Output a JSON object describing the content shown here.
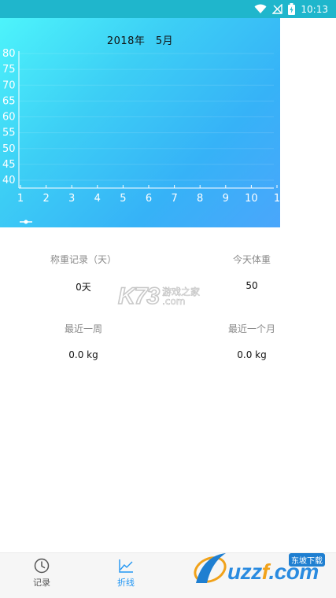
{
  "status_bar": {
    "time": "10:13",
    "icons": [
      "wifi-icon",
      "no-signal-icon",
      "battery-icon"
    ]
  },
  "chart": {
    "title": "2018年　5月",
    "colors": {
      "axis": "#ffffff",
      "grid": "#ffffff",
      "background_start": "#4df4fb",
      "background_end": "#4aa6fb"
    }
  },
  "chart_data": {
    "type": "line",
    "title": "2018年　5月",
    "x_ticks": [
      "1",
      "2",
      "3",
      "4",
      "5",
      "6",
      "7",
      "8",
      "9",
      "10",
      "1"
    ],
    "y_ticks": [
      "80",
      "75",
      "70",
      "65",
      "60",
      "55",
      "50",
      "45",
      "40"
    ],
    "ylim": [
      40,
      80
    ],
    "series": [],
    "grid": true,
    "legend": "bottom-left"
  },
  "stats": {
    "weigh_records_label": "称重记录（天）",
    "weigh_records_value": "0天",
    "today_weight_label": "今天体重",
    "today_weight_value": "50",
    "last_week_label": "最近一周",
    "last_week_value": "0.0 kg",
    "last_month_label": "最近一个月",
    "last_month_value": "0.0 kg"
  },
  "watermark": {
    "logo": "K73",
    "line1": "游戏之家",
    "line2": ".com"
  },
  "bottom_nav": {
    "items": [
      {
        "label": "记录",
        "icon": "clock-icon",
        "color": "#555555"
      },
      {
        "label": "折线",
        "icon": "line-chart-icon",
        "color": "#2196f3"
      }
    ]
  },
  "site_logo": {
    "text_main": "uzz",
    "text_f": "f",
    "text_tail": ".com",
    "badge": "东坡下载"
  }
}
